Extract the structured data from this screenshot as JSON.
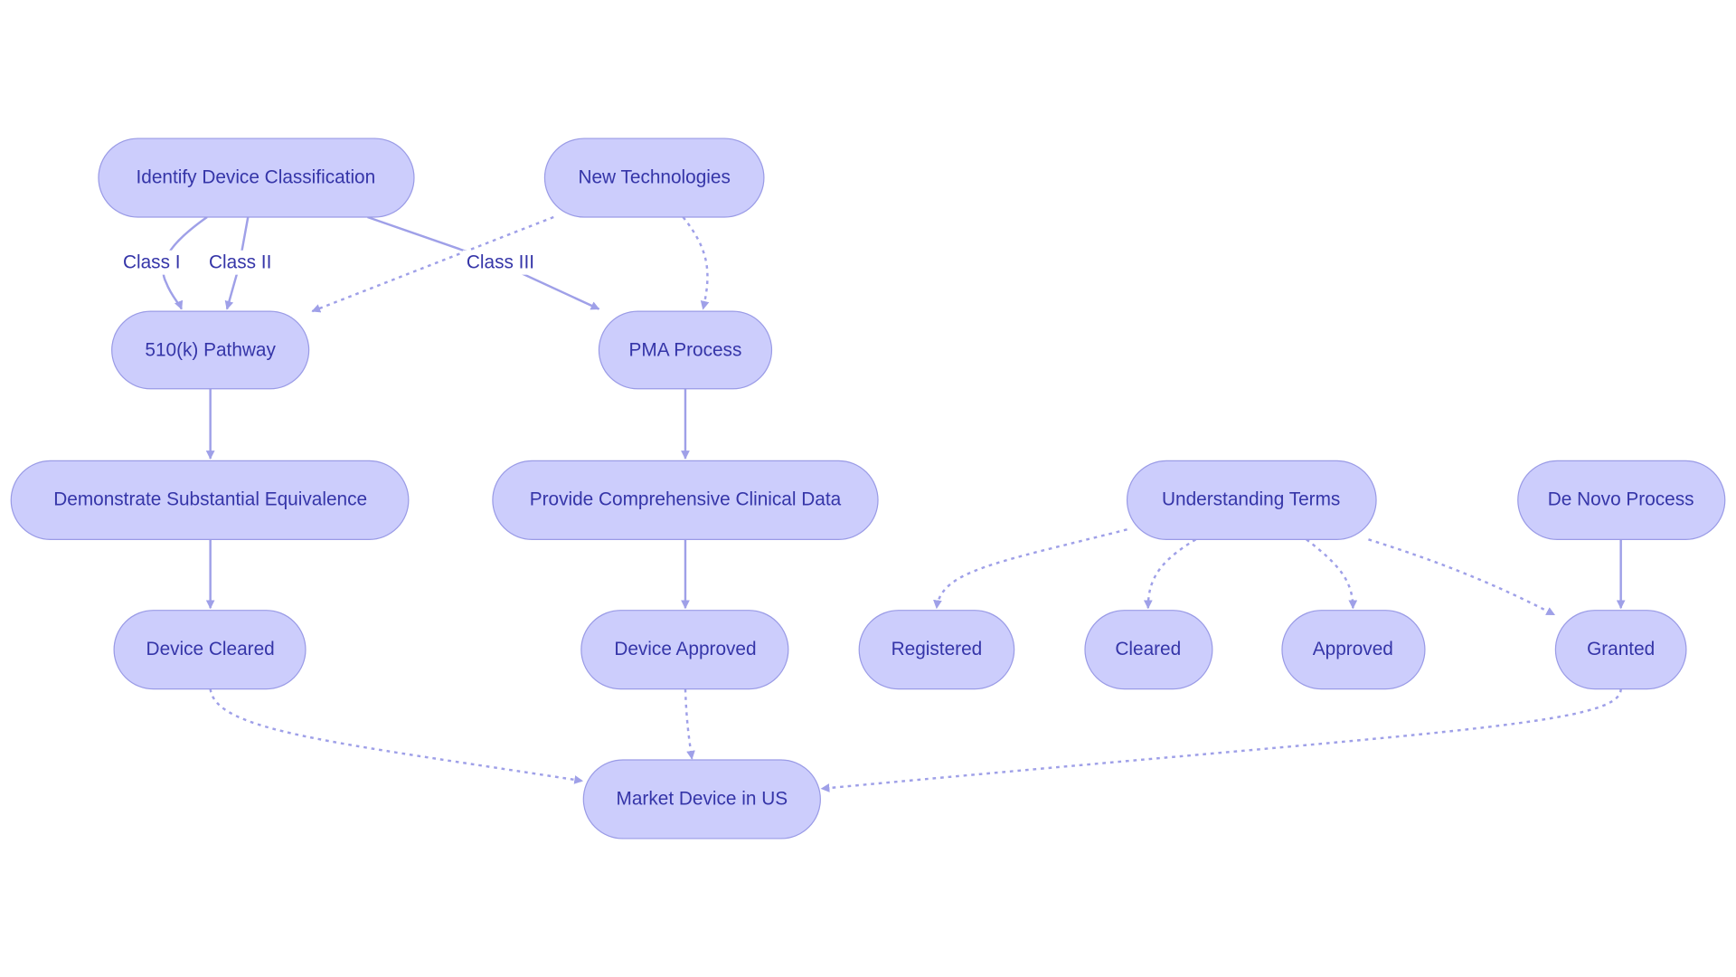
{
  "colors": {
    "node_fill": "#cccdfc",
    "node_stroke": "#9a9be6",
    "text": "#3535a8",
    "edge": "#9fa0e8"
  },
  "nodes": {
    "identify": "Identify Device Classification",
    "newtech": "New Technologies",
    "k510": "510(k) Pathway",
    "pma": "PMA Process",
    "demonstrate": "Demonstrate Substantial Equivalence",
    "provide": "Provide Comprehensive Clinical Data",
    "understanding": "Understanding Terms",
    "denovo": "De Novo Process",
    "cleared_dev": "Device Cleared",
    "approved_dev": "Device Approved",
    "registered": "Registered",
    "cleared": "Cleared",
    "approved": "Approved",
    "granted": "Granted",
    "market": "Market Device in US"
  },
  "edge_labels": {
    "class1": "Class I",
    "class2": "Class II",
    "class3": "Class III"
  }
}
